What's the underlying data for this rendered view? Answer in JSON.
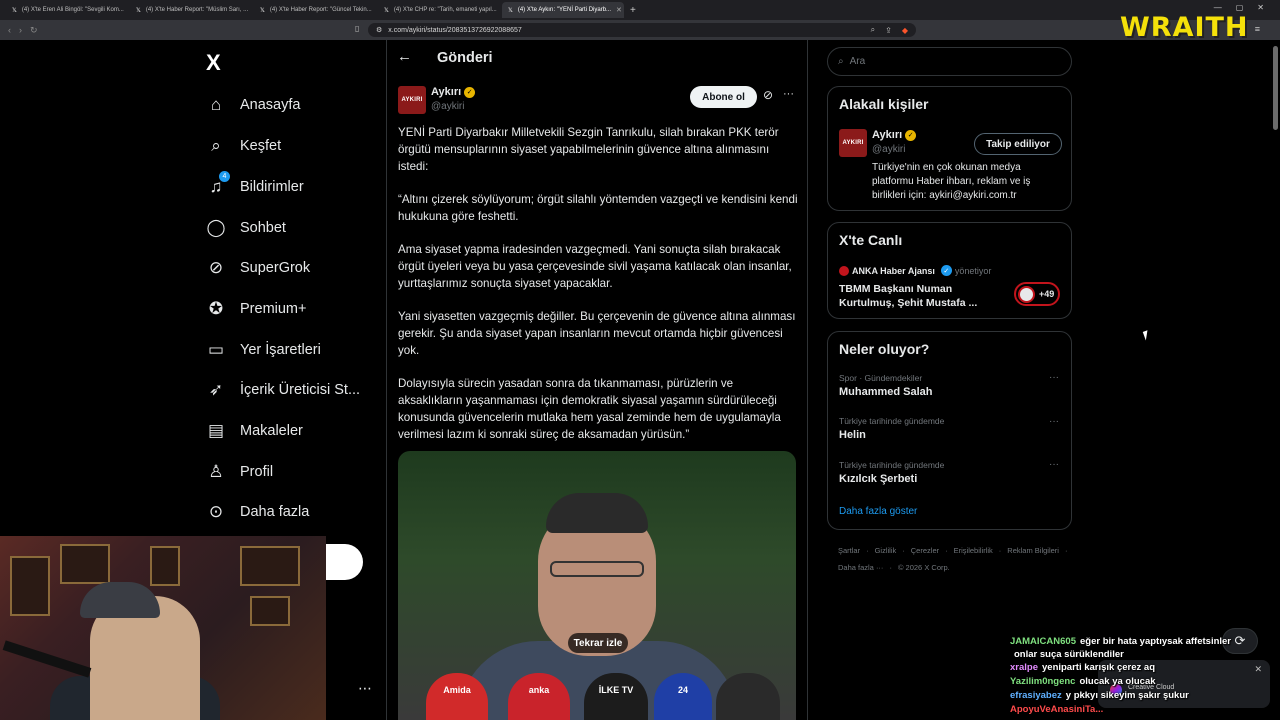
{
  "browser": {
    "tabs": [
      {
        "title": "(4) X'te Eren Ali Bingöl: \"Sevgili Kom...",
        "active": false
      },
      {
        "title": "(4) X'te Haber Report: \"Müslim Sarı, ...",
        "active": false
      },
      {
        "title": "(4) X'te Haber Report: \"Güncel Tekin...",
        "active": false
      },
      {
        "title": "(4) X'te CHP re: \"Tarih, emaneti yapıl...",
        "active": false
      },
      {
        "title": "(4) X'te Aykırı: \"YENİ Parti Diyarb...",
        "active": true
      }
    ],
    "url": "x.com/aykiri/status/2083513726922088657"
  },
  "overlay": {
    "brand": "WRAITH"
  },
  "nav": {
    "logo": "X",
    "items": [
      {
        "label": "Anasayfa",
        "icon": "home-icon",
        "glyph": "⌂"
      },
      {
        "label": "Keşfet",
        "icon": "search-icon",
        "glyph": "⌕"
      },
      {
        "label": "Bildirimler",
        "icon": "bell-icon",
        "glyph": "♫",
        "badge": "4"
      },
      {
        "label": "Sohbet",
        "icon": "chat-icon",
        "glyph": "◯"
      },
      {
        "label": "SuperGrok",
        "icon": "grok-icon",
        "glyph": "⊘"
      },
      {
        "label": "Premium+",
        "icon": "premium-icon",
        "glyph": "✪"
      },
      {
        "label": "Yer İşaretleri",
        "icon": "bookmark-icon",
        "glyph": "▭"
      },
      {
        "label": "İçerik Üreticisi St...",
        "icon": "rocket-icon",
        "glyph": "➶"
      },
      {
        "label": "Makaleler",
        "icon": "article-icon",
        "glyph": "▤"
      },
      {
        "label": "Profil",
        "icon": "profile-icon",
        "glyph": "♙"
      },
      {
        "label": "Daha fazla",
        "icon": "more-circle-icon",
        "glyph": "⊙"
      }
    ]
  },
  "post": {
    "header_title": "Gönderi",
    "author_name": "Aykırı",
    "author_handle": "@aykiri",
    "avatar_text": "AYKIRI",
    "subscribe_label": "Abone ol",
    "paragraphs": [
      "YENİ Parti Diyarbakır Milletvekili Sezgin Tanrıkulu, silah bırakan PKK terör örgütü mensuplarının siyaset yapabilmelerinin güvence altına alınmasını istedi:",
      "“Altını çizerek söylüyorum; örgüt silahlı yöntemden vazgeçti ve kendisini kendi hukukuna göre feshetti.",
      "Ama siyaset yapma iradesinden vazgeçmedi. Yani sonuçta silah bırakacak örgüt üyeleri veya bu yasa çerçevesinde sivil yaşama katılacak olan insanlar, yurttaşlarımız sonuçta siyaset yapacaklar.",
      "Yani siyasetten vazgeçmiş değiller. Bu çerçevenin de güvence altına alınması gerekir. Şu anda siyaset yapan insanların mevcut ortamda hiçbir güvencesi yok.",
      "Dolayısıyla sürecin yasadan sonra da tıkanmaması, pürüzlerin ve aksaklıkların yaşanmaması için demokratik siyasal yaşamın sürdürüleceği konusunda güvencelerin mutlaka hem yasal zeminde hem de uygulamayla verilmesi lazım ki sonraki süreç de aksamadan yürüsün.”"
    ],
    "video": {
      "replay_label": "Tekrar izle",
      "mic_labels": [
        "Amida",
        "anka",
        "İLKE TV",
        "24",
        ""
      ]
    }
  },
  "sidebar": {
    "search_placeholder": "Ara",
    "related": {
      "title": "Alakalı kişiler",
      "name": "Aykırı",
      "handle": "@aykiri",
      "avatar_text": "AYKIRI",
      "follow_label": "Takip ediliyor",
      "bio": "Türkiye'nin en çok okunan medya platformu Haber ihbarı, reklam ve iş birlikleri için: aykiri@aykiri.com.tr"
    },
    "live": {
      "title": "X'te Canlı",
      "source": "ANKA Haber Ajansı",
      "role": "yönetiyor",
      "headline": "TBMM Başkanı Numan Kurtulmuş, Şehit Mustafa ...",
      "count": "+49"
    },
    "trends": {
      "title": "Neler oluyor?",
      "items": [
        {
          "meta": "Spor · Gündemdekiler",
          "name": "Muhammed Salah"
        },
        {
          "meta": "Türkiye tarihinde gündemde",
          "name": "Helin"
        },
        {
          "meta": "Türkiye tarihinde gündemde",
          "name": "Kızılcık Şerbeti"
        }
      ],
      "show_more": "Daha fazla göster"
    },
    "footer": [
      "Şartlar",
      "Gizlilik",
      "Çerezler",
      "Erişilebilirlik",
      "Reklam Bilgileri",
      "Daha fazla ···",
      "© 2026 X Corp."
    ]
  },
  "chat": {
    "lines": [
      {
        "user": "JAMAICAN605",
        "color": "#7fe07f",
        "text": "eğer bir hata yaptıysak affetsinler"
      },
      {
        "user": "",
        "color": "#ffffff",
        "text": "onlar suça sürüklendiler"
      },
      {
        "user": "xralpe",
        "color": "#e48cff",
        "text": "yeniparti karışık çerez aq"
      },
      {
        "user": "Yazilim0ngenc",
        "color": "#7fe07f",
        "text": "olucak ya olucak"
      },
      {
        "user": "efrasiyabez",
        "color": "#5fb0ff",
        "text": "y pkkyı sikeyim şakır şukur"
      },
      {
        "user": "ApoyuVeAnasiniTa...",
        "color": "#ff4b4b",
        "text": ""
      }
    ],
    "notification": "Creative Cloud"
  }
}
